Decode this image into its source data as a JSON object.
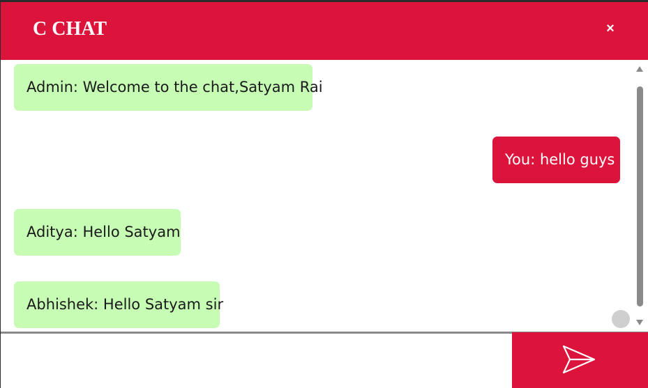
{
  "header": {
    "title": "C CHAT",
    "close_label": "×"
  },
  "messages": [
    {
      "author": "Admin",
      "text": "Admin: Welcome to the chat,Satyam Rai",
      "direction": "incoming"
    },
    {
      "author": "You",
      "text": "You: hello guys",
      "direction": "outgoing"
    },
    {
      "author": "Aditya",
      "text": "Aditya: Hello Satyam",
      "direction": "incoming"
    },
    {
      "author": "Abhishek",
      "text": "Abhishek: Hello Satyam sir",
      "direction": "incoming"
    }
  ],
  "composer": {
    "input_value": "",
    "input_placeholder": "",
    "send_icon": "send-icon"
  },
  "colors": {
    "brand": "#dc143c",
    "incoming_bubble": "#c6fcb4",
    "outgoing_bubble": "#dc143c",
    "scrollbar": "#8a8a8a"
  }
}
